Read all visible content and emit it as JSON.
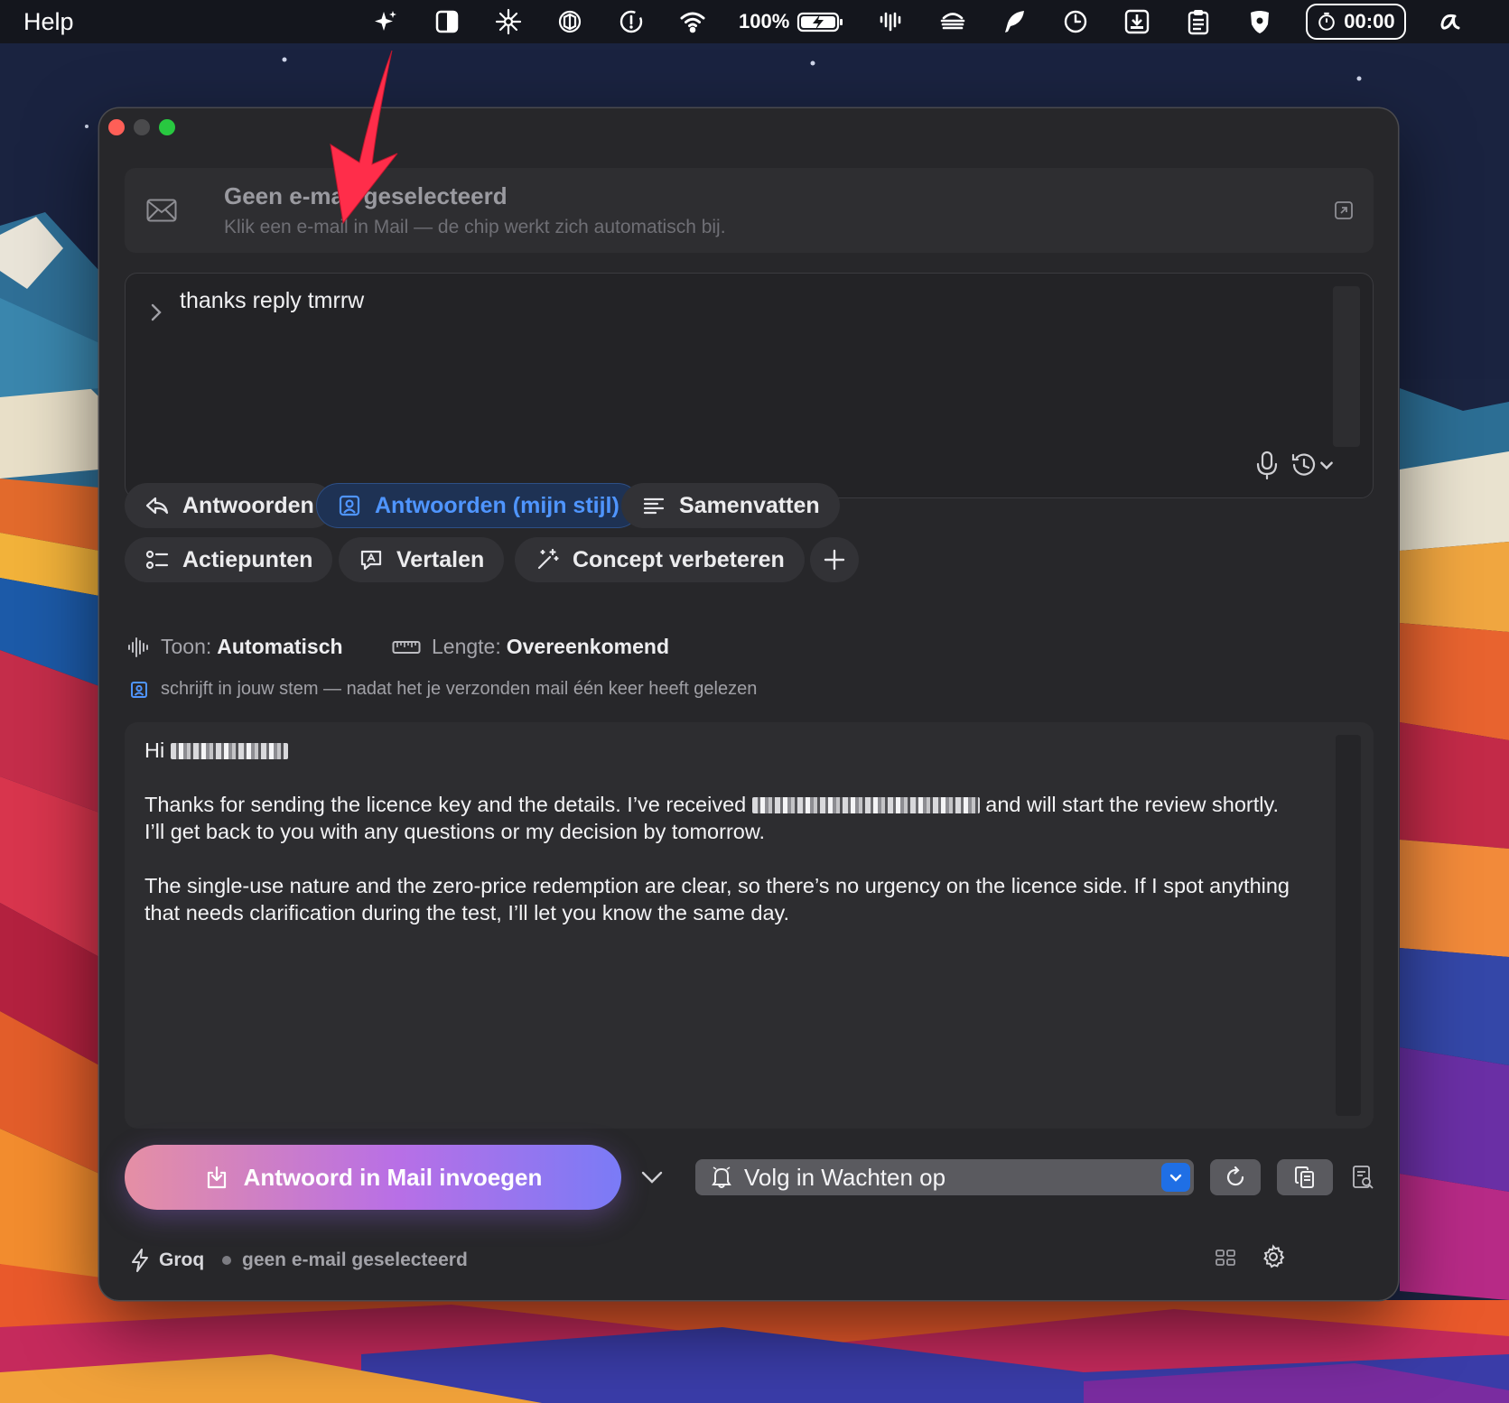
{
  "menubar": {
    "app_menu": "Help",
    "battery_percent": "100%",
    "timer": "00:00",
    "tray_icons": [
      "sparkle-icon",
      "contrast-icon",
      "snowflake-icon",
      "openai-icon",
      "alert-icon",
      "wifi-icon",
      "battery-icon",
      "waveform-icon",
      "burger-icon",
      "feather-icon",
      "clock-icon",
      "download-box-icon",
      "clipboard-icon",
      "shield-icon",
      "timer-icon",
      "script-a-icon"
    ]
  },
  "chip": {
    "title": "Geen e-mail geselecteerd",
    "subtitle": "Klik een e-mail in Mail — de chip werkt zich automatisch bij."
  },
  "prompt": {
    "text": "thanks reply tmrrw"
  },
  "actions": {
    "reply": "Antwoorden",
    "reply_my_style": "Antwoorden (mijn stijl)",
    "summarize": "Samenvatten",
    "action_items": "Actiepunten",
    "translate": "Vertalen",
    "improve_draft": "Concept verbeteren"
  },
  "settings": {
    "tone_label": "Toon:",
    "tone_value": "Automatisch",
    "length_label": "Lengte:",
    "length_value": "Overeenkomend"
  },
  "hint": "schrijft in jouw stem — nadat het je verzonden mail één keer heeft gelezen",
  "draft": {
    "greeting": "Hi",
    "p1_before": "Thanks for sending the licence key and the details. I’ve received",
    "p1_after": "and will start the review shortly. I’ll get back to you with any questions or my decision by tomorrow.",
    "p2": "The single-use nature and the zero-price redemption are clear, so there’s no urgency on the licence side. If I spot anything that needs clarification during the test, I’ll let you know the same day."
  },
  "bottom": {
    "insert_label": "Antwoord in Mail invoegen",
    "followup_label": "Volg in Wachten op"
  },
  "footer": {
    "provider": "Groq",
    "status": "geen e-mail geselecteerd"
  },
  "colors": {
    "accent_blue": "#4f95ff",
    "window_bg": "#27272a",
    "insert_gradient_start": "#e58fa4",
    "insert_gradient_end": "#7a7bf6",
    "annotation_arrow": "#ff2d4a"
  }
}
